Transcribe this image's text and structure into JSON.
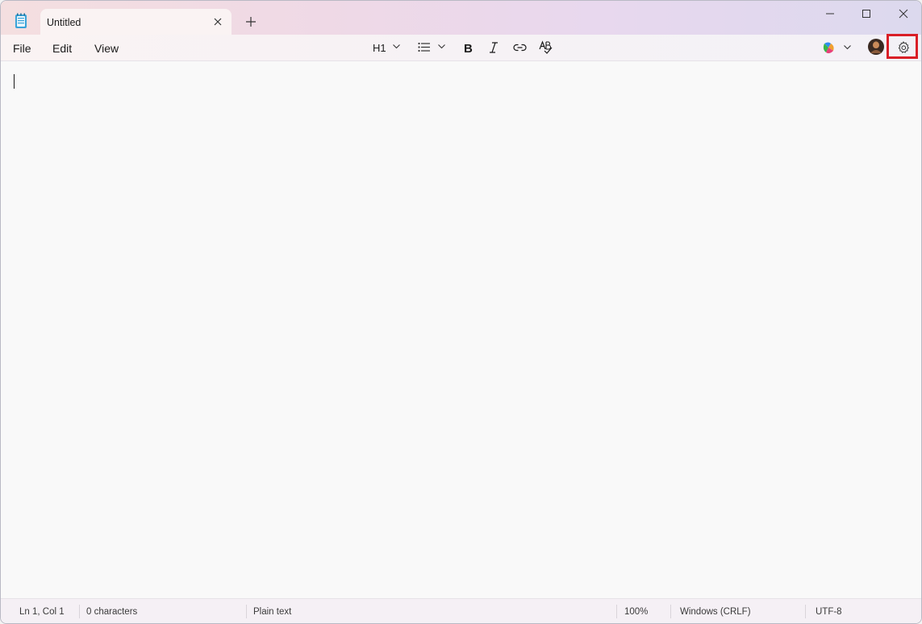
{
  "tab": {
    "title": "Untitled"
  },
  "menu": {
    "file": "File",
    "edit": "Edit",
    "view": "View"
  },
  "toolbar": {
    "heading_label": "H1"
  },
  "status": {
    "position": "Ln 1, Col 1",
    "characters": "0 characters",
    "format": "Plain text",
    "zoom": "100%",
    "line_ending": "Windows (CRLF)",
    "encoding": "UTF-8"
  },
  "colors": {
    "highlight": "#d91e26",
    "accent": "#0067c0"
  },
  "icons": [
    "notepad-icon",
    "close-icon",
    "plus-icon",
    "minimize-icon",
    "maximize-icon",
    "bold-icon",
    "italic-icon",
    "link-icon",
    "spellcheck-icon",
    "list-icon",
    "copilot-icon",
    "avatar",
    "gear-icon"
  ]
}
